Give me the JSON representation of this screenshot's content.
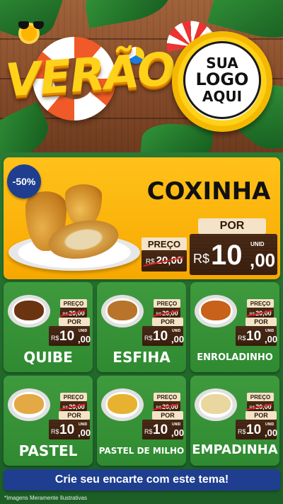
{
  "header": {
    "title": "VERÃO",
    "logo_line1": "SUA",
    "logo_line2": "LOGO",
    "logo_line3": "AQUI"
  },
  "featured": {
    "badge": "-50%",
    "name": "COXINHA",
    "preco_label": "PREÇO",
    "old_currency": "R$",
    "old_price": "20,00",
    "por_label": "POR",
    "new_currency": "R$",
    "new_price_int": "10",
    "new_price_dec": ",00",
    "unit": "UNID"
  },
  "products": [
    {
      "name": "QUIBE",
      "preco_label": "PREÇO",
      "old_currency": "R$",
      "old_price": "20,00",
      "por_label": "POR",
      "new_currency": "R$",
      "new_price_int": "10",
      "new_price_dec": ",00",
      "unit": "UNID"
    },
    {
      "name": "ESFIHA",
      "preco_label": "PREÇO",
      "old_currency": "R$",
      "old_price": "20,00",
      "por_label": "POR",
      "new_currency": "R$",
      "new_price_int": "10",
      "new_price_dec": ",00",
      "unit": "UNID"
    },
    {
      "name": "ENROLADINHO",
      "preco_label": "PREÇO",
      "old_currency": "R$",
      "old_price": "20,00",
      "por_label": "POR",
      "new_currency": "R$",
      "new_price_int": "10",
      "new_price_dec": ",00",
      "unit": "UNID"
    },
    {
      "name": "PASTEL",
      "preco_label": "PREÇO",
      "old_currency": "R$",
      "old_price": "20,00",
      "por_label": "POR",
      "new_currency": "R$",
      "new_price_int": "10",
      "new_price_dec": ",00",
      "unit": "UNID"
    },
    {
      "name": "PASTEL DE MILHO",
      "preco_label": "PREÇO",
      "old_currency": "R$",
      "old_price": "20,00",
      "por_label": "POR",
      "new_currency": "R$",
      "new_price_int": "10",
      "new_price_dec": ",00",
      "unit": "UNID"
    },
    {
      "name": "EMPADINHA",
      "preco_label": "PREÇO",
      "old_currency": "R$",
      "old_price": "20,00",
      "por_label": "POR",
      "new_currency": "R$",
      "new_price_int": "10",
      "new_price_dec": ",00",
      "unit": "UNID"
    }
  ],
  "cta": "Crie seu encarte com este tema!",
  "disclaimer": "*Imagens Meramente Ilustrativas",
  "colors": {
    "header_wood": "#8a4f2c",
    "title_yellow": "#ffd21a",
    "hero_yellow": "#ffc21a",
    "card_green": "#3f9a3e",
    "badge_blue": "#1f3e8f",
    "price_wood": "#3a1f0e",
    "price_cream": "#f4e3c7",
    "strike_red": "#e02020"
  }
}
